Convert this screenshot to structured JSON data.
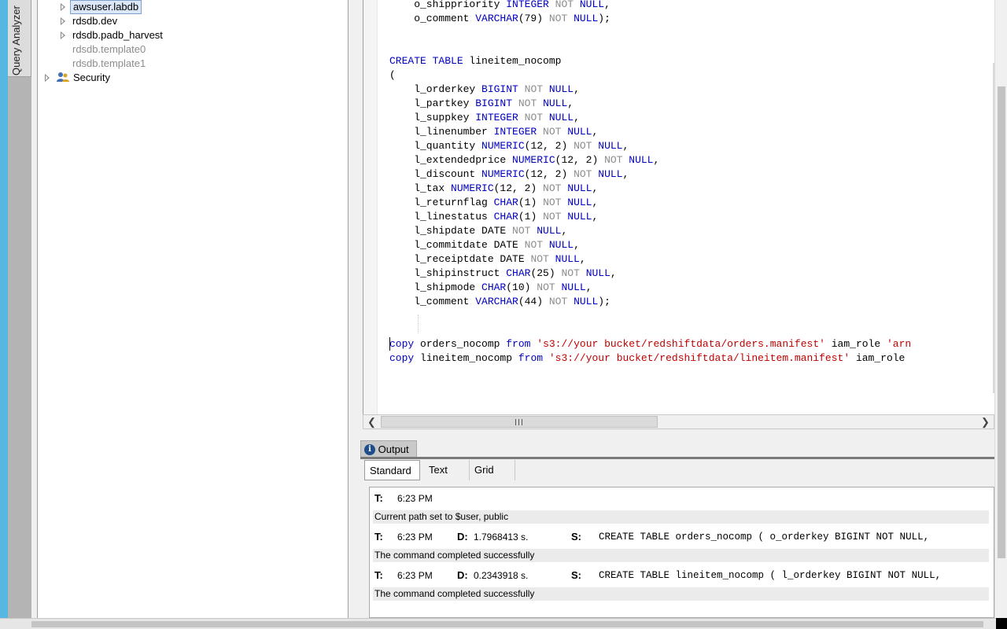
{
  "sidebar": {
    "vertical_tab_label": "Query Analyzer"
  },
  "tree": {
    "items": [
      {
        "label": "awsuser.labdb",
        "expandable": true,
        "selected": true
      },
      {
        "label": "rdsdb.dev",
        "expandable": true
      },
      {
        "label": "rdsdb.padb_harvest",
        "expandable": true
      },
      {
        "label": "rdsdb.template0",
        "expandable": false,
        "disabled": true
      },
      {
        "label": "rdsdb.template1",
        "expandable": false,
        "disabled": true
      },
      {
        "label": "Security",
        "expandable": true,
        "icon": "users-icon"
      }
    ]
  },
  "editor": {
    "colors": {
      "keyword": "#0000c0",
      "not_null": "#8c8c8c",
      "string": "#c00000"
    },
    "lines": [
      "    o_shippriority INTEGER NOT NULL,",
      "    o_comment VARCHAR(79) NOT NULL);",
      "",
      "",
      "CREATE TABLE lineitem_nocomp",
      "(",
      "    l_orderkey BIGINT NOT NULL,",
      "    l_partkey BIGINT NOT NULL,",
      "    l_suppkey INTEGER NOT NULL,",
      "    l_linenumber INTEGER NOT NULL,",
      "    l_quantity NUMERIC(12, 2) NOT NULL,",
      "    l_extendedprice NUMERIC(12, 2) NOT NULL,",
      "    l_discount NUMERIC(12, 2) NOT NULL,",
      "    l_tax NUMERIC(12, 2) NOT NULL,",
      "    l_returnflag CHAR(1) NOT NULL,",
      "    l_linestatus CHAR(1) NOT NULL,",
      "    l_shipdate DATE NOT NULL,",
      "    l_commitdate DATE NOT NULL,",
      "    l_receiptdate DATE NOT NULL,",
      "    l_shipinstruct CHAR(25) NOT NULL,",
      "    l_shipmode CHAR(10) NOT NULL,",
      "    l_comment VARCHAR(44) NOT NULL);",
      "",
      "",
      "copy orders_nocomp from 's3://your bucket/redshiftdata/orders.manifest' iam_role 'arn",
      "copy lineitem_nocomp from 's3://your bucket/redshiftdata/lineitem.manifest' iam_role"
    ]
  },
  "output": {
    "tab_label": "Output",
    "subtabs": [
      "Standard",
      "Text",
      "Grid"
    ],
    "active_subtab": "Standard",
    "entries": [
      {
        "t_label": "T:",
        "time": "6:23 PM",
        "message": "Current path set to $user, public"
      },
      {
        "t_label": "T:",
        "time": "6:23 PM",
        "d_label": "D:",
        "duration": "1.7968413 s.",
        "s_label": "S:",
        "statement": "CREATE TABLE orders_nocomp (  o_orderkey BIGINT NOT NULL,",
        "message": "The command completed successfully"
      },
      {
        "t_label": "T:",
        "time": "6:23 PM",
        "d_label": "D:",
        "duration": "0.2343918 s.",
        "s_label": "S:",
        "statement": "CREATE TABLE lineitem_nocomp (  l_orderkey BIGINT NOT NULL,",
        "message": "The command completed successfully"
      }
    ]
  }
}
